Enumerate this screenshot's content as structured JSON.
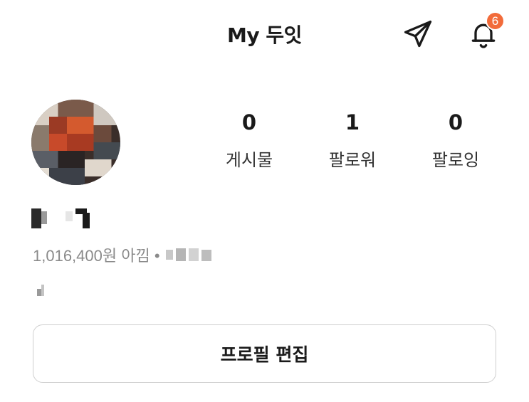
{
  "header": {
    "title": "My 두잇",
    "send_icon": "paper-plane-icon",
    "bell_icon": "bell-icon",
    "notification_count": "6",
    "badge_color": "#f26b3a"
  },
  "profile": {
    "avatar": "avatar-image (pixelated)",
    "stats": [
      {
        "value": "0",
        "label": "게시물"
      },
      {
        "value": "1",
        "label": "팔로워"
      },
      {
        "value": "0",
        "label": "팔로잉"
      }
    ],
    "saved_amount": "1,016,400원 아낌 •"
  },
  "actions": {
    "edit_profile_label": "프로필 편집"
  }
}
